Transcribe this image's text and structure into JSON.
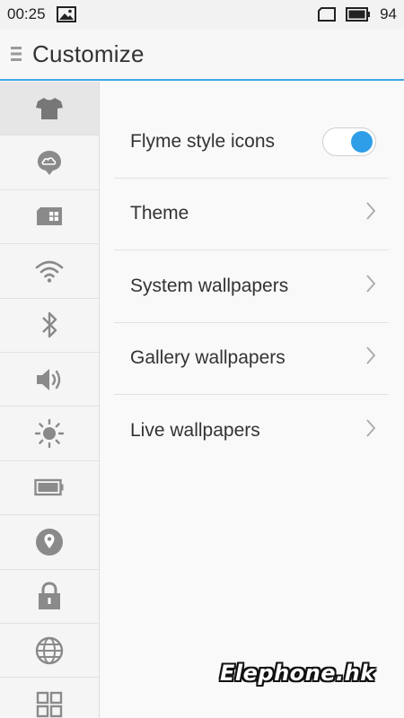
{
  "status_bar": {
    "time": "00:25",
    "battery_level": "94",
    "icons": [
      "image-notification-icon",
      "screen-icon",
      "battery-icon"
    ]
  },
  "header": {
    "title": "Customize",
    "menu_icon": "menu-icon"
  },
  "sidebar": {
    "items": [
      {
        "icon": "shirt-icon",
        "active": true
      },
      {
        "icon": "cloud-pin-icon",
        "active": false
      },
      {
        "icon": "sim-card-icon",
        "active": false
      },
      {
        "icon": "wifi-icon",
        "active": false
      },
      {
        "icon": "bluetooth-icon",
        "active": false
      },
      {
        "icon": "speaker-icon",
        "active": false
      },
      {
        "icon": "brightness-icon",
        "active": false
      },
      {
        "icon": "battery-icon",
        "active": false
      },
      {
        "icon": "location-icon",
        "active": false
      },
      {
        "icon": "lock-icon",
        "active": false
      },
      {
        "icon": "globe-icon",
        "active": false
      },
      {
        "icon": "apps-grid-icon",
        "active": false
      }
    ]
  },
  "settings": {
    "flyme_icons": {
      "label": "Flyme style icons",
      "enabled": true
    },
    "theme": {
      "label": "Theme"
    },
    "system_wallpapers": {
      "label": "System wallpapers"
    },
    "gallery_wallpapers": {
      "label": "Gallery wallpapers"
    },
    "live_wallpapers": {
      "label": "Live wallpapers"
    }
  },
  "colors": {
    "accent": "#2f9ee8",
    "icon_gray": "#8a8a8a",
    "background": "#f7f7f7"
  },
  "watermark": "Elephone.hk"
}
